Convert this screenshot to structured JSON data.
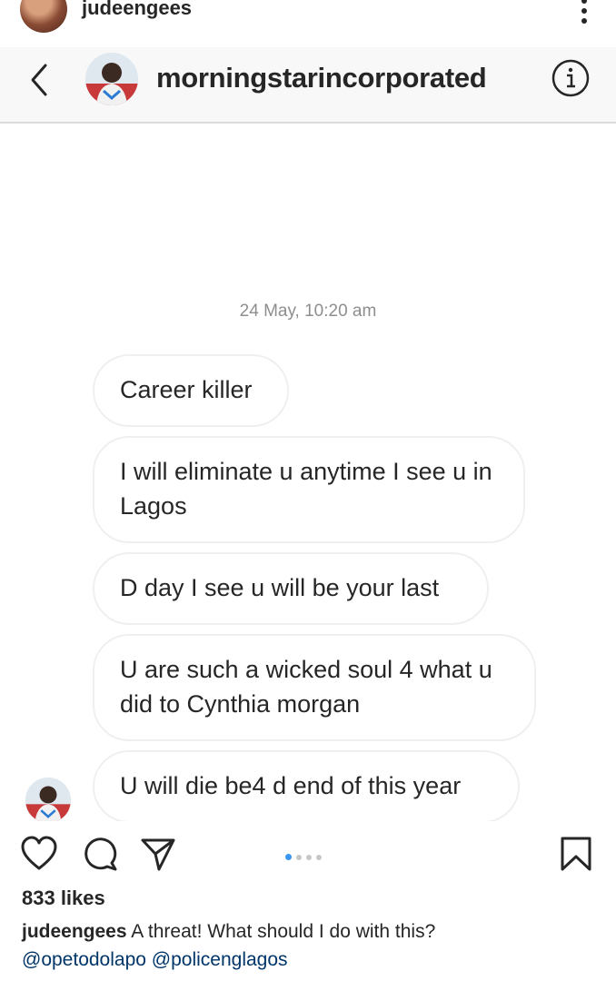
{
  "post": {
    "username": "judeengees",
    "likes": "833 likes",
    "caption": {
      "username": "judeengees",
      "text": "A threat! What should I do with this?",
      "mentions": [
        "@opetodolapo",
        "@policenglagos"
      ]
    },
    "carousel": {
      "total": 4,
      "active": 0
    }
  },
  "dm": {
    "username": "morningstarincorporated",
    "timestamp": "24 May, 10:20 am",
    "messages": [
      "Career killer",
      "I will eliminate u anytime I see u in Lagos",
      "D day I see u will be your last",
      "U are such a wicked soul 4 what u did to Cynthia morgan",
      "U will die be4 d end of this year"
    ]
  },
  "icons": {
    "more": "more-vertical-icon",
    "back": "chevron-left-icon",
    "info": "info-icon",
    "like": "heart-icon",
    "comment": "comment-icon",
    "share": "send-icon",
    "save": "bookmark-icon"
  },
  "colors": {
    "text": "#262626",
    "muted": "#8e8e8e",
    "mention": "#003569",
    "carousel_active": "#3897f0"
  }
}
